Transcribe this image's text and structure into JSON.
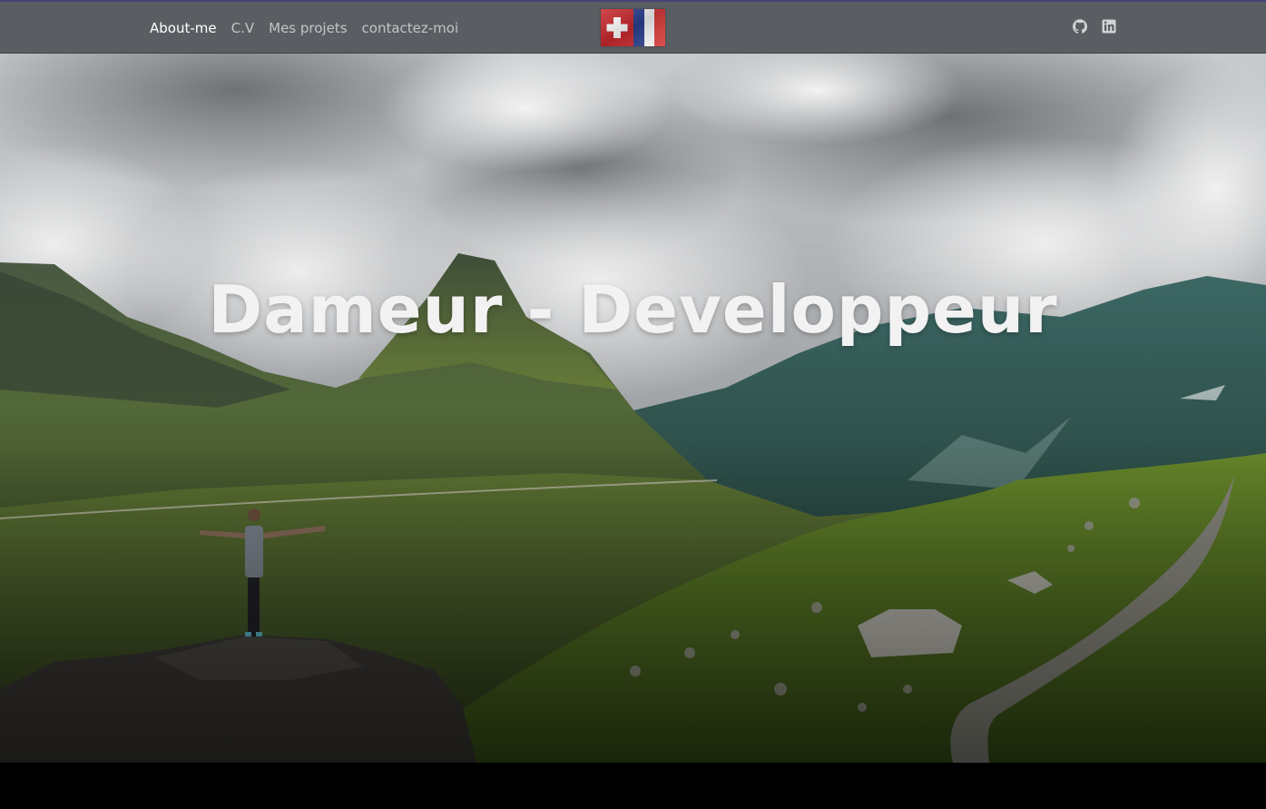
{
  "nav": {
    "items": [
      {
        "label": "About-me",
        "active": true
      },
      {
        "label": "C.V",
        "active": false
      },
      {
        "label": "Mes projets",
        "active": false
      },
      {
        "label": "contactez-moi",
        "active": false
      }
    ]
  },
  "flag": {
    "icon": "swiss-french-flag-icon"
  },
  "social": {
    "icons": [
      "github-icon",
      "linkedin-icon"
    ]
  },
  "hero": {
    "title": "Dameur - Developpeur"
  },
  "colors": {
    "topbar_bg": "#5a5e62",
    "nav_active": "#ffffff",
    "nav_inactive": "#c2c5c8",
    "title": "#f2f2f2"
  }
}
